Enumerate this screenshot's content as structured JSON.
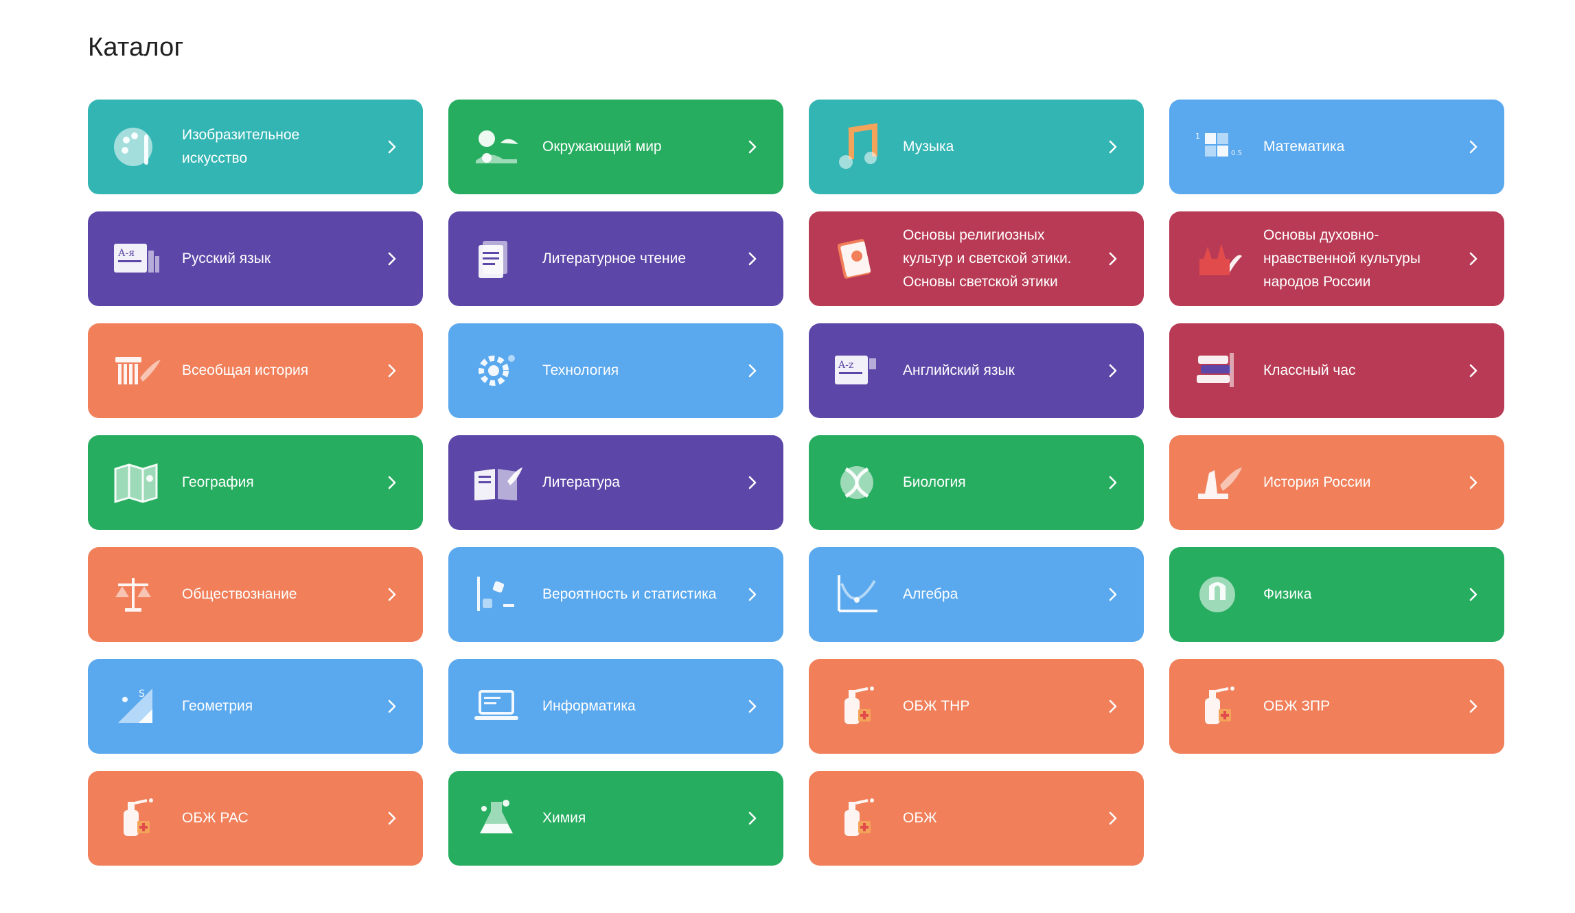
{
  "page": {
    "title": "Каталог"
  },
  "colors": {
    "teal": "#33b5b3",
    "green": "#26ad60",
    "blue": "#5aa8ee",
    "purple": "#5c47a8",
    "crimson": "#b83a55",
    "orange": "#f07f5a"
  },
  "cards": [
    {
      "label": "Изобразительное\nискусство",
      "color": "teal",
      "icon": "palette-icon"
    },
    {
      "label": "Окружающий мир",
      "color": "green",
      "icon": "nature-icon"
    },
    {
      "label": "Музыка",
      "color": "teal",
      "icon": "music-note-icon"
    },
    {
      "label": "Математика",
      "color": "blue",
      "icon": "math-blocks-icon"
    },
    {
      "label": "Русский язык",
      "color": "purple",
      "icon": "russian-alphabet-icon"
    },
    {
      "label": "Литературное чтение",
      "color": "purple",
      "icon": "document-icon"
    },
    {
      "label": "Основы религиозных\nкультур и светской этики.\nОсновы светской этики",
      "color": "crimson",
      "icon": "book-icon"
    },
    {
      "label": "Основы духовно-\nнравственной культуры\nнародов России",
      "color": "crimson",
      "icon": "kremlin-icon"
    },
    {
      "label": "Всеобщая история",
      "color": "orange",
      "icon": "column-icon"
    },
    {
      "label": "Технология",
      "color": "blue",
      "icon": "gear-icon"
    },
    {
      "label": "Английский язык",
      "color": "purple",
      "icon": "english-alphabet-icon"
    },
    {
      "label": "Классный час",
      "color": "crimson",
      "icon": "books-stack-icon"
    },
    {
      "label": "География",
      "color": "green",
      "icon": "map-icon"
    },
    {
      "label": "Литература",
      "color": "purple",
      "icon": "open-book-icon"
    },
    {
      "label": "Биология",
      "color": "green",
      "icon": "dna-icon"
    },
    {
      "label": "История России",
      "color": "orange",
      "icon": "monument-icon"
    },
    {
      "label": "Обществознание",
      "color": "orange",
      "icon": "scales-icon"
    },
    {
      "label": "Вероятность и статистика",
      "color": "blue",
      "icon": "dice-chart-icon"
    },
    {
      "label": "Алгебра",
      "color": "blue",
      "icon": "graph-icon"
    },
    {
      "label": "Физика",
      "color": "green",
      "icon": "magnet-icon"
    },
    {
      "label": "Геометрия",
      "color": "blue",
      "icon": "ruler-triangle-icon"
    },
    {
      "label": "Информатика",
      "color": "blue",
      "icon": "laptop-icon"
    },
    {
      "label": "ОБЖ ТНР",
      "color": "orange",
      "icon": "fire-extinguisher-icon"
    },
    {
      "label": "ОБЖ ЗПР",
      "color": "orange",
      "icon": "fire-extinguisher-icon"
    },
    {
      "label": "ОБЖ РАС",
      "color": "orange",
      "icon": "fire-extinguisher-icon"
    },
    {
      "label": "Химия",
      "color": "green",
      "icon": "flask-icon"
    },
    {
      "label": "ОБЖ",
      "color": "orange",
      "icon": "fire-extinguisher-icon"
    }
  ]
}
